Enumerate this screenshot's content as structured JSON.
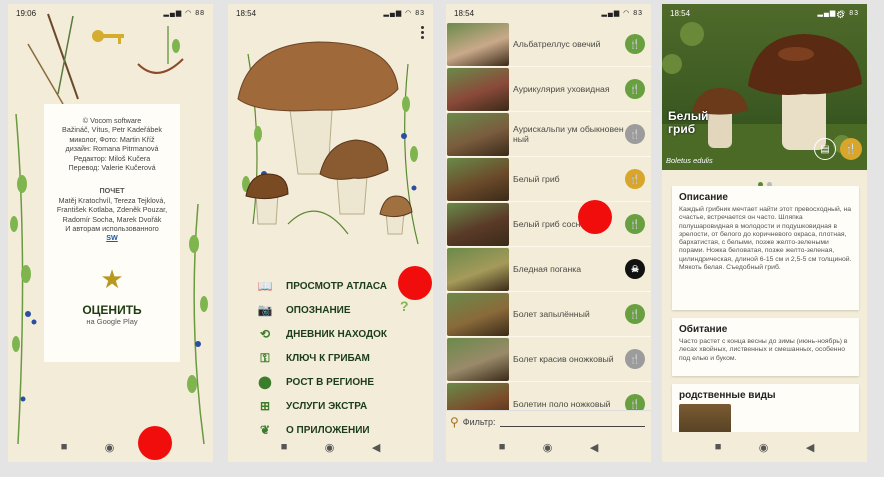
{
  "colors": {
    "accent": "#3b7d2a",
    "tap": "#f20d0d",
    "badge_green": "#68a040",
    "badge_grey": "#9c9c9c",
    "badge_yellow": "#d7a62a",
    "badge_black": "#111111"
  },
  "screens": [
    {
      "time": "19:06",
      "status_icons": "▂▄▆ ◠ 88"
    },
    {
      "time": "18:54",
      "status_icons": "▂▄▆ ◠ 83"
    },
    {
      "time": "18:54",
      "status_icons": "▂▄▆ ◠ 83"
    },
    {
      "time": "18:54",
      "status_icons": "▂▄▆ ◠ 83"
    }
  ],
  "nav": {
    "recent": "■",
    "home": "◉",
    "back": "◀"
  },
  "about": {
    "lines": [
      "© Vocom software",
      "Bažináč, Vítus, Petr Kadeřábek",
      "миколог, Фото: Martin Kříž",
      "дизайн: Romana Pitrmanová",
      "Редактор: Miloš Kučera",
      "Перевод: Valerie Kučerová"
    ],
    "thanks_title": "ПОЧЕТ",
    "thanks_text": "Matěj Kratochvíl, Tereza Tejklová, František Kotlaba, Zdeněk Pouzar, Radomír Socha, Marek Dvořák",
    "authors_text": "И авторам использованного",
    "sw_link": "SW",
    "star": "★",
    "rate_label": "ОЦЕНИТЬ",
    "rate_sub": "на Google Play"
  },
  "menu": {
    "items": [
      {
        "icon": "book-icon",
        "glyph": "📖",
        "label": "ПРОСМОТР АТЛАСА"
      },
      {
        "icon": "camera-icon",
        "glyph": "📷",
        "label": "ОПОЗНАНИЕ"
      },
      {
        "icon": "history-icon",
        "glyph": "⟲",
        "label": "ДНЕВНИК НАХОДОК"
      },
      {
        "icon": "key-icon",
        "glyph": "⚿",
        "label": "КЛЮЧ К ГРИБАМ"
      },
      {
        "icon": "location-pin-icon",
        "glyph": "⬤",
        "label": "РОСТ В РЕГИОНЕ"
      },
      {
        "icon": "extras-icon",
        "glyph": "⊞",
        "label": "УСЛУГИ ЭКСТРА"
      },
      {
        "icon": "info-leaf-icon",
        "glyph": "❦",
        "label": "О ПРИЛОЖЕНИИ"
      }
    ],
    "question_mark": "?"
  },
  "species_list": {
    "items": [
      {
        "name": "Альбатреллус овечий",
        "edibility": "edible",
        "badge": "🍴",
        "color": "#68a040",
        "thumb": "#c9a98a"
      },
      {
        "name": "Аурикулярия уховидная",
        "edibility": "edible",
        "badge": "🍴",
        "color": "#68a040",
        "thumb": "#8b4a3a"
      },
      {
        "name": "Аурискальпи ум обыкновен ный",
        "edibility": "inedible",
        "badge": "🍴",
        "color": "#9c9c9c",
        "thumb": "#7a5c3e"
      },
      {
        "name": "Белый гриб",
        "edibility": "choice",
        "badge": "🍴",
        "color": "#d7a62a",
        "thumb": "#6b4a2a"
      },
      {
        "name": "Белый гриб сосновый",
        "edibility": "edible",
        "badge": "🍴",
        "color": "#68a040",
        "thumb": "#5a3a28"
      },
      {
        "name": "Бледная поганка",
        "edibility": "deadly",
        "badge": "☠",
        "color": "#111111",
        "thumb": "#a59a5a"
      },
      {
        "name": "Болет запылённый",
        "edibility": "edible",
        "badge": "🍴",
        "color": "#68a040",
        "thumb": "#8a6a3a"
      },
      {
        "name": "Болет красив оножковый",
        "edibility": "inedible",
        "badge": "🍴",
        "color": "#9c9c9c",
        "thumb": "#9a8a6a"
      },
      {
        "name": "Болетин поло ножковый",
        "edibility": "edible",
        "badge": "🍴",
        "color": "#68a040",
        "thumb": "#7a4a2a"
      }
    ],
    "filter_label": "Фильтр:"
  },
  "detail": {
    "title_line1": "Белый",
    "title_line2": "гриб",
    "latin": "Boletus edulis",
    "description_title": "Описание",
    "description_text": "Каждый грибник мечтает найти этот превосходный, на счастье, встречается он часто. Шляпка полушаровидная в молодости и подушковидная в зрелости, от белого до коричневого окраса, плотная, бархатистая, с белыми, позже желто-зелеными порами. Ножка беловатая, позже желто-зеленая, цилиндрическая, длиной 6-15 см и 2,5-5 см толщиной. Мякоть белая. Съедобный гриб.",
    "habitat_title": "Обитание",
    "habitat_text": "Часто растет с конца весны до зимы (июнь-ноябрь) в лесах хвойных, лиственных и смешанных, особенно под елью и буком.",
    "related_title": "родственные виды"
  }
}
